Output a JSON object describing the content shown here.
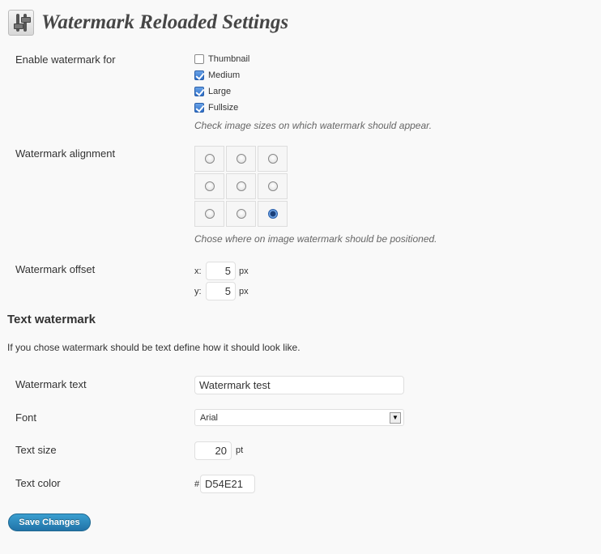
{
  "header": {
    "title": "Watermark Reloaded Settings",
    "icon": "settings-sliders-icon"
  },
  "enable": {
    "label": "Enable watermark for",
    "options": [
      {
        "label": "Thumbnail",
        "checked": false
      },
      {
        "label": "Medium",
        "checked": true
      },
      {
        "label": "Large",
        "checked": true
      },
      {
        "label": "Fullsize",
        "checked": true
      }
    ],
    "description": "Check image sizes on which watermark should appear."
  },
  "alignment": {
    "label": "Watermark alignment",
    "selected": "bottom-right",
    "description": "Chose where on image watermark should be positioned."
  },
  "offset": {
    "label": "Watermark offset",
    "x_label": "x:",
    "x_value": "5",
    "y_label": "y:",
    "y_value": "5",
    "unit": "px"
  },
  "text_section": {
    "title": "Text watermark",
    "description": "If you chose watermark should be text define how it should look like."
  },
  "watermark_text": {
    "label": "Watermark text",
    "value": "Watermark test"
  },
  "font": {
    "label": "Font",
    "value": "Arial"
  },
  "text_size": {
    "label": "Text size",
    "value": "20",
    "unit": "pt"
  },
  "text_color": {
    "label": "Text color",
    "prefix": "#",
    "value": "D54E21"
  },
  "save_button": {
    "label": "Save Changes",
    "color": "#2173a8"
  }
}
